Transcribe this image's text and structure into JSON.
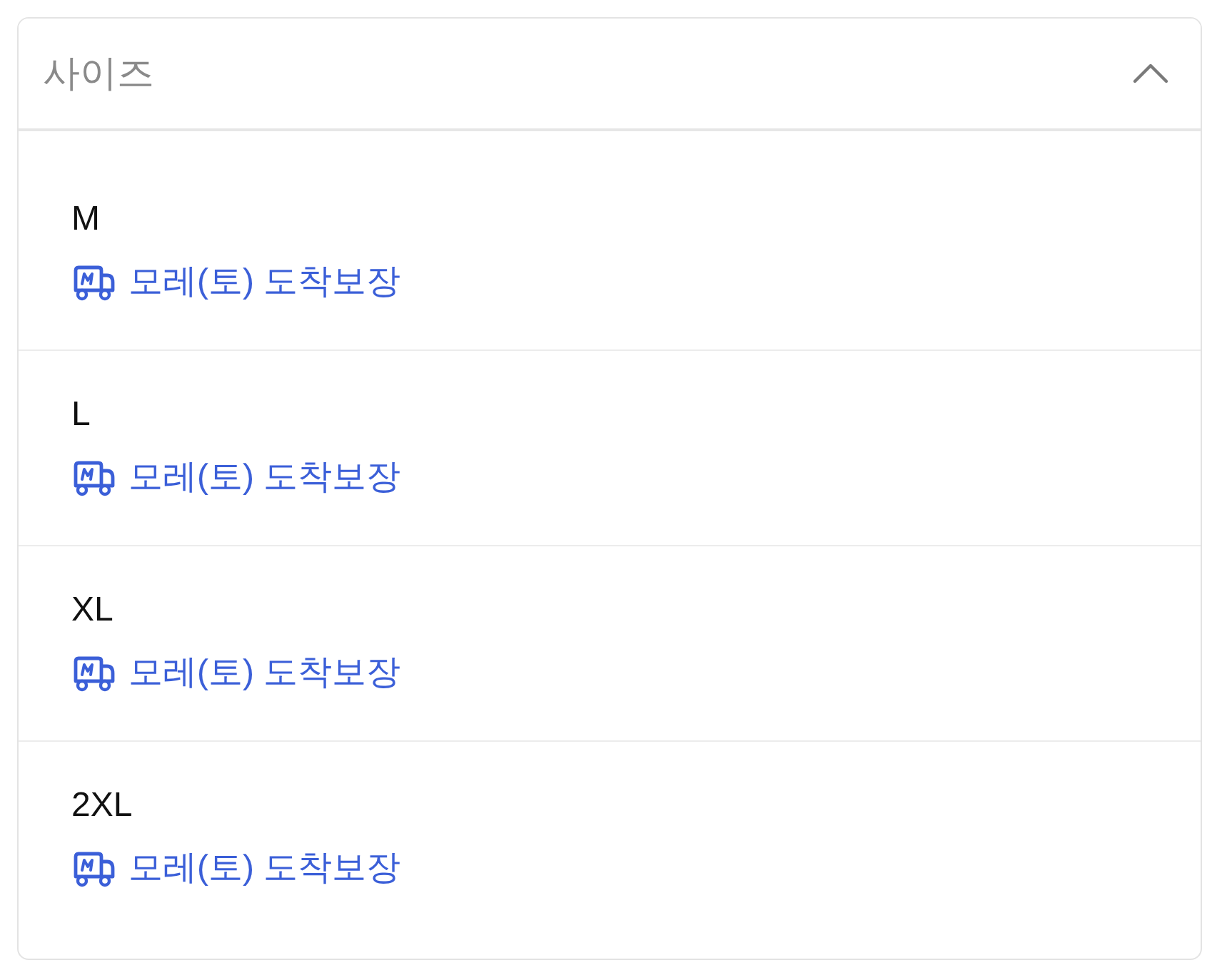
{
  "accordion": {
    "title": "사이즈",
    "expanded": true
  },
  "options": [
    {
      "size": "M",
      "delivery": "모레(토) 도착보장"
    },
    {
      "size": "L",
      "delivery": "모레(토) 도착보장"
    },
    {
      "size": "XL",
      "delivery": "모레(토) 도착보장"
    },
    {
      "size": "2XL",
      "delivery": "모레(토) 도착보장"
    }
  ]
}
